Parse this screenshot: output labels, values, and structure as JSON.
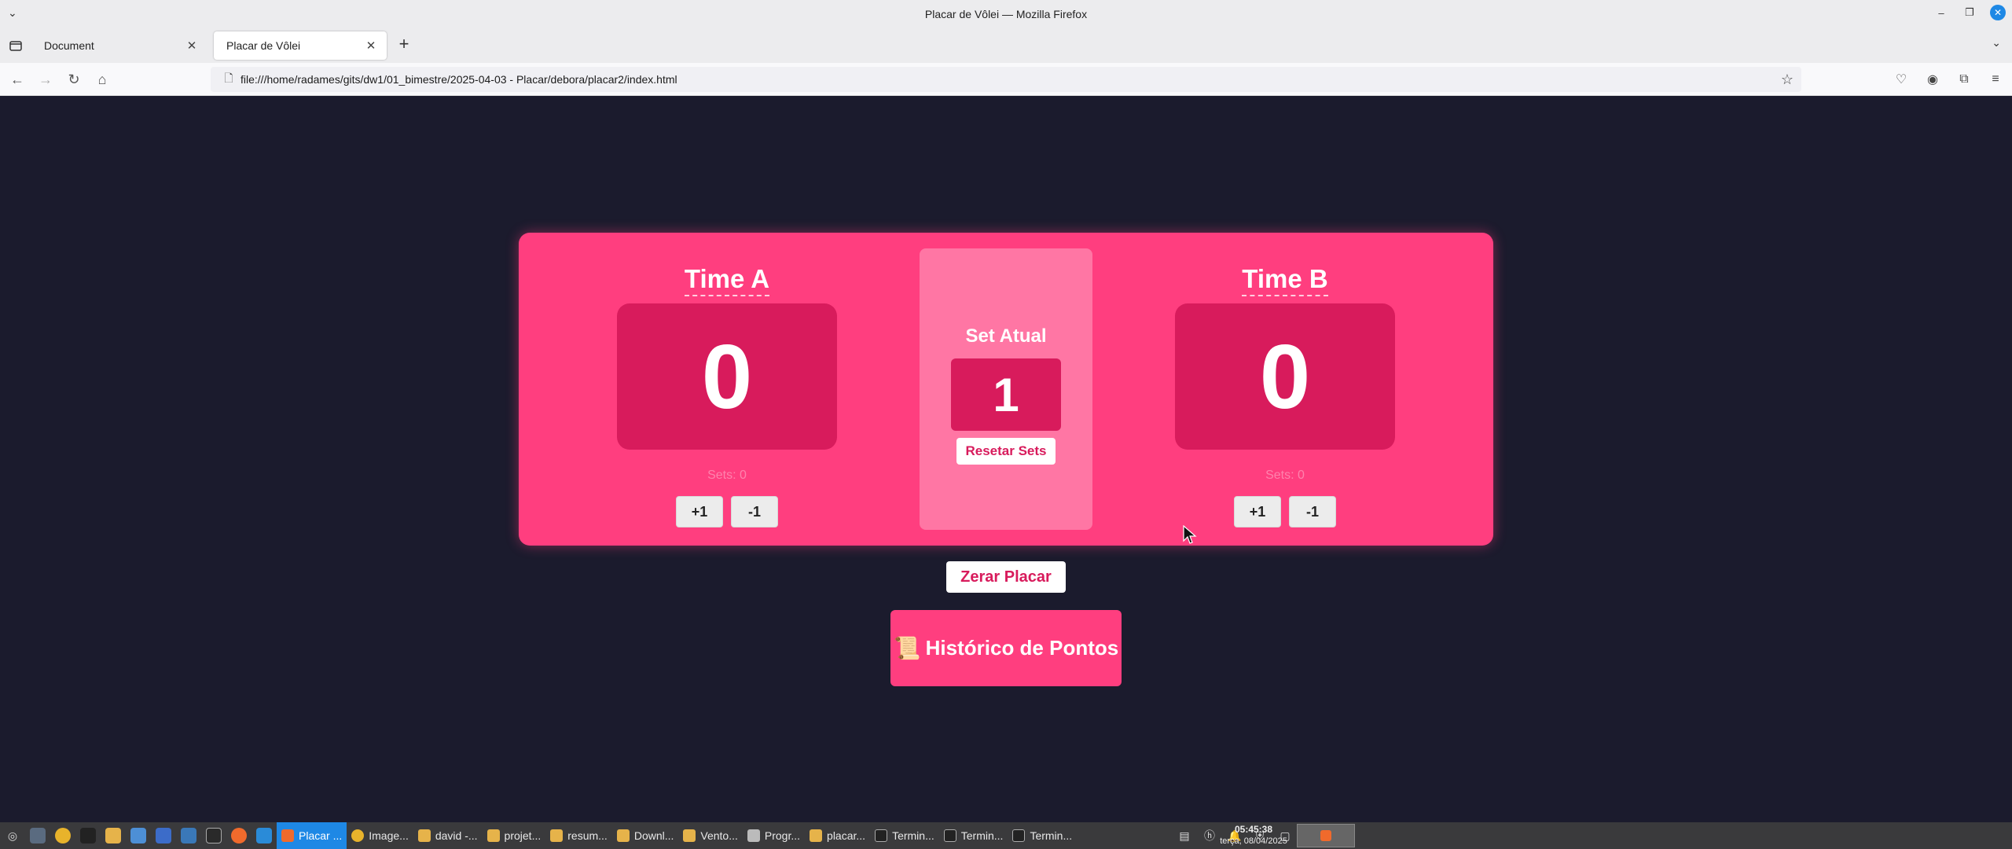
{
  "window": {
    "title": "Placar de Vôlei — Mozilla Firefox"
  },
  "tabs": [
    {
      "label": "Document",
      "active": false
    },
    {
      "label": "Placar de Vôlei",
      "active": true
    }
  ],
  "navbar": {
    "url": "file:///home/radames/gits/dw1/01_bimestre/2025-04-03 - Placar/debora/placar2/index.html"
  },
  "scoreboard": {
    "team_a": {
      "name": "Time A",
      "score": "0",
      "sets": "Sets: 0",
      "plus": "+1",
      "minus": "-1"
    },
    "team_b": {
      "name": "Time B",
      "score": "0",
      "sets": "Sets: 0",
      "plus": "+1",
      "minus": "-1"
    },
    "set_panel": {
      "title": "Set Atual",
      "value": "1",
      "reset_label": "Resetar Sets"
    },
    "reset_label": "Zerar Placar",
    "history_label": "Histórico de Pontos",
    "history_icon": "📜"
  },
  "colors": {
    "background": "#1b1b2d",
    "board": "#ff3e7f",
    "score_box": "#d81b5c",
    "set_panel": "#ff76a4",
    "taskbar_active": "#1e88e5"
  },
  "taskbar": {
    "tasks": [
      {
        "label": "Placar ...",
        "active": true,
        "icon": "firefox-icon"
      },
      {
        "label": "Image...",
        "active": false,
        "icon": "chrome-icon"
      },
      {
        "label": "david -...",
        "active": false,
        "icon": "folder-icon"
      },
      {
        "label": "projet...",
        "active": false,
        "icon": "folder-icon"
      },
      {
        "label": "resum...",
        "active": false,
        "icon": "folder-icon"
      },
      {
        "label": "Downl...",
        "active": false,
        "icon": "folder-icon"
      },
      {
        "label": "Vento...",
        "active": false,
        "icon": "folder-icon"
      },
      {
        "label": "Progr...",
        "active": false,
        "icon": "window-icon"
      },
      {
        "label": "placar...",
        "active": false,
        "icon": "folder-icon"
      },
      {
        "label": "Termin...",
        "active": false,
        "icon": "terminal-icon"
      },
      {
        "label": "Termin...",
        "active": false,
        "icon": "terminal-icon"
      },
      {
        "label": "Termin...",
        "active": false,
        "icon": "terminal-icon"
      }
    ],
    "clock_time": "05:45:38",
    "clock_date": "terça, 08/04/2025"
  }
}
